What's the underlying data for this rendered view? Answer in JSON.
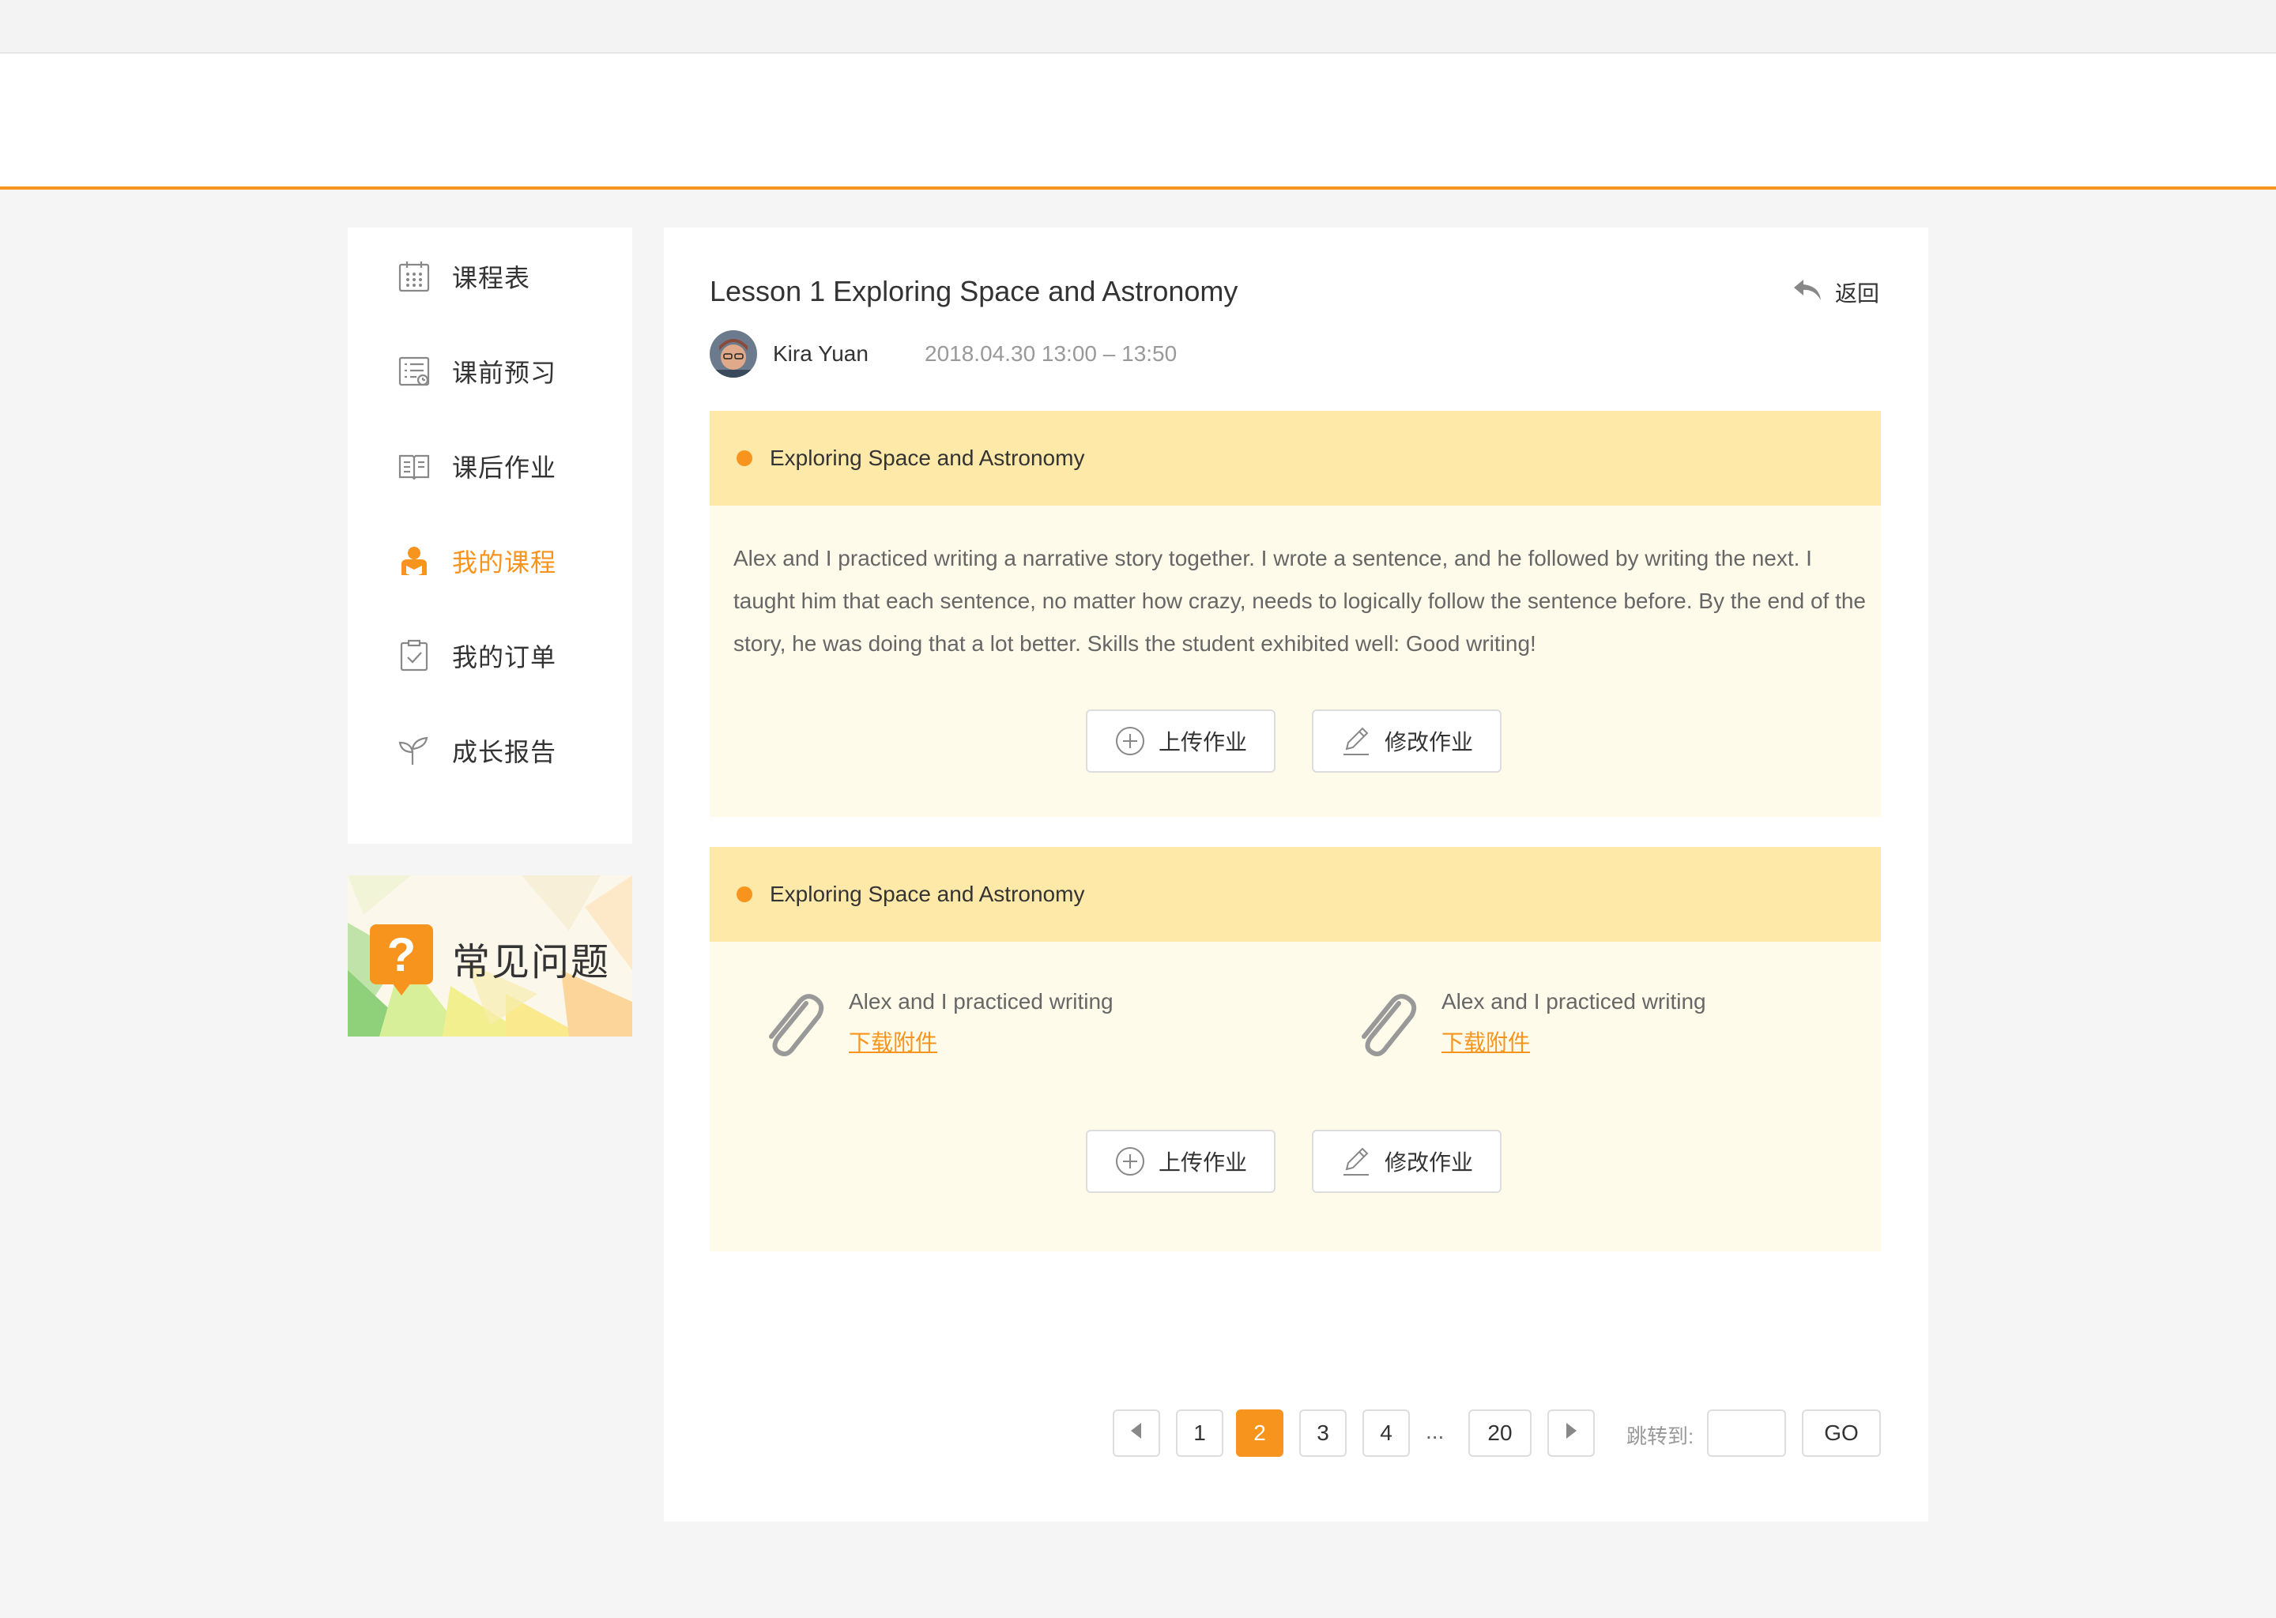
{
  "sidebar": {
    "items": [
      {
        "label": "课程表",
        "icon": "calendar-icon",
        "active": false
      },
      {
        "label": "课前预习",
        "icon": "checklist-icon",
        "active": false
      },
      {
        "label": "课后作业",
        "icon": "open-book-icon",
        "active": false
      },
      {
        "label": "我的课程",
        "icon": "student-icon",
        "active": true
      },
      {
        "label": "我的订单",
        "icon": "clipboard-check-icon",
        "active": false
      },
      {
        "label": "成长报告",
        "icon": "sprout-icon",
        "active": false
      }
    ]
  },
  "faq": {
    "title": "常见问题",
    "badge": "?"
  },
  "lesson": {
    "title": "Lesson 1 Exploring Space and Astronomy",
    "back_label": "返回",
    "teacher": "Kira Yuan",
    "time": "2018.04.30 13:00 – 13:50"
  },
  "blocks": [
    {
      "heading": "Exploring Space and Astronomy",
      "text": "Alex and I practiced writing a narrative story together. I wrote a sentence, and he followed by writing the next. I taught him that each sentence, no matter how crazy, needs to logically follow the sentence before. By the end of the story, he was doing that a lot better. Skills the student exhibited well: Good writing!",
      "upload_label": "上传作业",
      "edit_label": "修改作业"
    },
    {
      "heading": "Exploring Space and Astronomy",
      "attachments": [
        {
          "name": "Alex and I practiced writing",
          "download_label": "下载附件"
        },
        {
          "name": "Alex and I practiced writing",
          "download_label": "下载附件"
        }
      ],
      "upload_label": "上传作业",
      "edit_label": "修改作业"
    }
  ],
  "pagination": {
    "pages": [
      "1",
      "2",
      "3",
      "4",
      "20"
    ],
    "current": "2",
    "ellipsis": "...",
    "jump_label": "跳转到:",
    "jump_value": "",
    "go_label": "GO"
  },
  "colors": {
    "accent": "#f7941d",
    "block_head": "#fee9a8",
    "block_body": "#fffbea"
  }
}
